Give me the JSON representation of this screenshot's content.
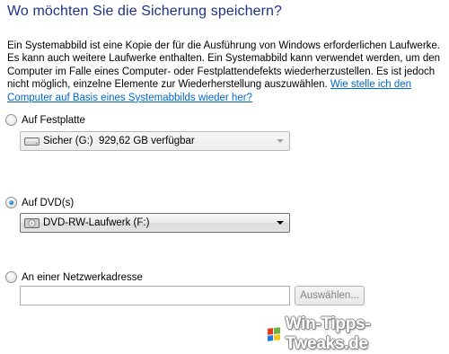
{
  "heading": "Wo möchten Sie die Sicherung speichern?",
  "description": {
    "text": "Ein Systemabbild ist eine Kopie der für die Ausführung von Windows erforderlichen Laufwerke. Es kann auch weitere Laufwerke enthalten. Ein Systemabbild kann verwendet werden, um den Computer im Falle eines Computer- oder Festplattendefekts wiederherzustellen. Es ist jedoch nicht möglich, einzelne Elemente zur Wiederherstellung auszuwählen. ",
    "link": "Wie stelle ich den Computer auf Basis eines Systemabbilds wieder her?"
  },
  "options": {
    "harddisk": {
      "label": "Auf Festplatte",
      "selected": false,
      "combo_value": "Sicher (G:)  929,62 GB verfügbar",
      "combo_icon": "hard-drive-icon"
    },
    "dvd": {
      "label": "Auf DVD(s)",
      "selected": true,
      "combo_value": "DVD-RW-Laufwerk (F:)",
      "combo_icon": "dvd-drive-icon"
    },
    "network": {
      "label": "An einer Netzwerkadresse",
      "selected": false,
      "path_value": "",
      "browse_label": "Auswählen..."
    }
  },
  "watermark": {
    "text": "Win-Tipps-Tweaks.de",
    "icon": "windows-logo-icon"
  },
  "colors": {
    "heading": "#1e3287",
    "link": "#0066cc"
  }
}
